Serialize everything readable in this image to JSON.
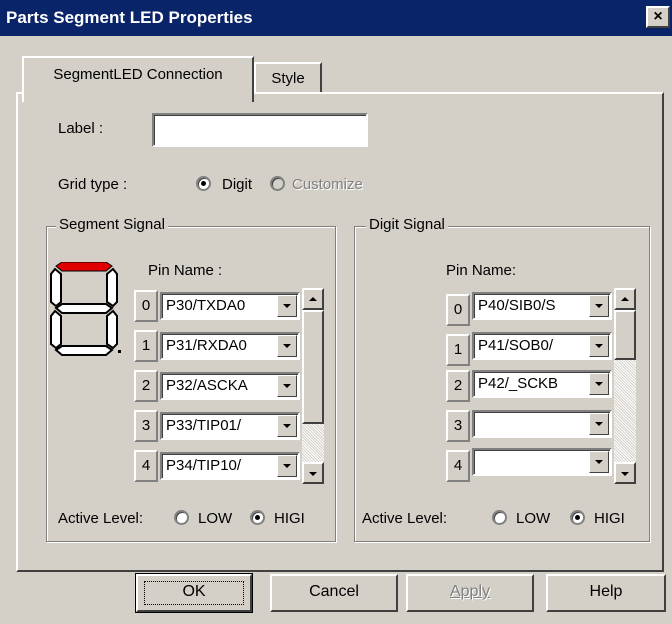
{
  "window": {
    "title": "Parts Segment LED Properties",
    "close_glyph": "×"
  },
  "tabs": [
    {
      "label": "SegmentLED Connection",
      "active": true
    },
    {
      "label": "Style",
      "active": false
    }
  ],
  "label_field": {
    "label": "Label :",
    "value": ""
  },
  "grid_type": {
    "label": "Grid type :",
    "options": [
      {
        "label": "Digit",
        "selected": true,
        "enabled": true
      },
      {
        "label": "Customize",
        "selected": false,
        "enabled": false
      }
    ]
  },
  "segment_signal": {
    "title": "Segment Signal",
    "pin_name_header": "Pin Name :",
    "accent_color": "#e00000",
    "icon": "seven-segment-digit-icon",
    "rows": [
      {
        "index": "0",
        "value": "P30/TXDA0"
      },
      {
        "index": "1",
        "value": "P31/RXDA0"
      },
      {
        "index": "2",
        "value": "P32/ASCKA"
      },
      {
        "index": "3",
        "value": "P33/TIP01/"
      },
      {
        "index": "4",
        "value": "P34/TIP10/"
      }
    ],
    "active_level": {
      "label": "Active Level:",
      "options": [
        {
          "label": "LOW",
          "selected": false
        },
        {
          "label": "HIGI",
          "selected": true
        }
      ]
    }
  },
  "digit_signal": {
    "title": "Digit Signal",
    "pin_name_header": "Pin Name:",
    "rows": [
      {
        "index": "0",
        "value": "P40/SIB0/S"
      },
      {
        "index": "1",
        "value": "P41/SOB0/"
      },
      {
        "index": "2",
        "value": "P42/_SCKB"
      },
      {
        "index": "3",
        "value": ""
      },
      {
        "index": "4",
        "value": ""
      }
    ],
    "active_level": {
      "label": "Active Level:",
      "options": [
        {
          "label": "LOW",
          "selected": false
        },
        {
          "label": "HIGI",
          "selected": true
        }
      ]
    }
  },
  "buttons": {
    "ok": "OK",
    "cancel": "Cancel",
    "apply": "Apply",
    "help": "Help"
  }
}
